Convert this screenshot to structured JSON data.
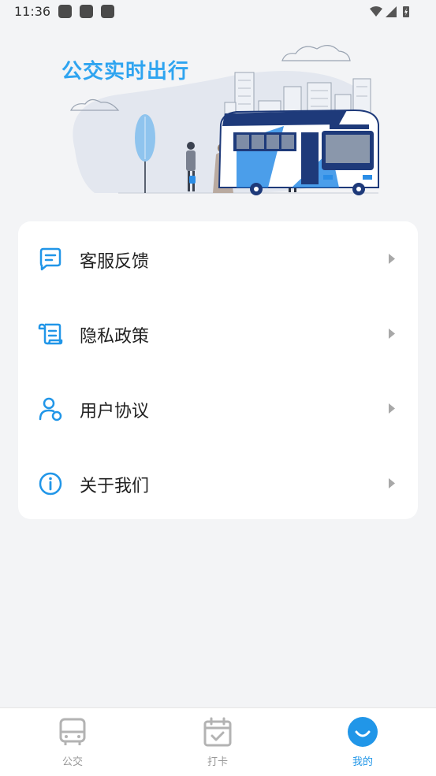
{
  "status_bar": {
    "time": "11:36"
  },
  "banner": {
    "title": "公交实时出行"
  },
  "menu": {
    "items": [
      {
        "label": "客服反馈",
        "icon": "feedback-icon"
      },
      {
        "label": "隐私政策",
        "icon": "privacy-scroll-icon"
      },
      {
        "label": "用户协议",
        "icon": "user-agreement-icon"
      },
      {
        "label": "关于我们",
        "icon": "info-icon"
      }
    ]
  },
  "bottom_nav": {
    "items": [
      {
        "label": "公交",
        "icon": "bus-icon",
        "active": false
      },
      {
        "label": "打卡",
        "icon": "calendar-check-icon",
        "active": false
      },
      {
        "label": "我的",
        "icon": "smile-icon",
        "active": true
      }
    ]
  },
  "colors": {
    "accent": "#2196e8",
    "banner_title": "#2ea4f0",
    "background": "#f3f4f6"
  }
}
